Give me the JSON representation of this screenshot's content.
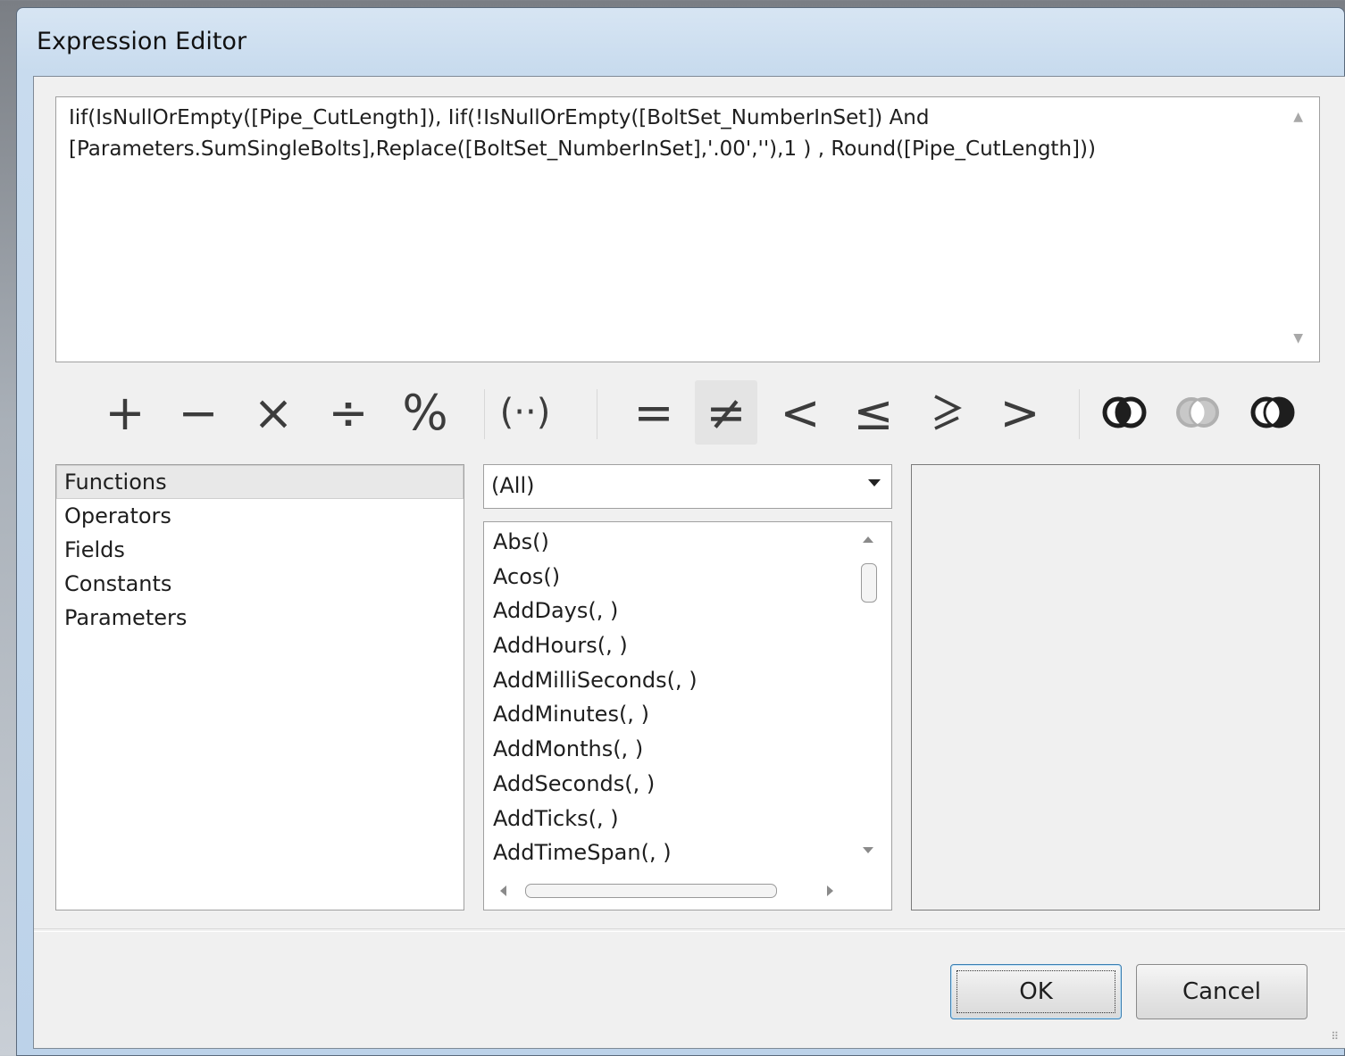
{
  "window": {
    "title": "Expression Editor"
  },
  "expression": {
    "text": "Iif(IsNullOrEmpty([Pipe_CutLength]), Iif(!IsNullOrEmpty([BoltSet_NumberInSet]) And\n[Parameters.SumSingleBolts],Replace([BoltSet_NumberInSet],'.00',''),1 ) , Round([Pipe_CutLength]))"
  },
  "toolbar": {
    "arithmetic": [
      "+",
      "−",
      "×",
      "÷",
      "%"
    ],
    "grouping": "(··)",
    "comparison": [
      "=",
      "≠",
      "<",
      "≤",
      ">",
      ">"
    ],
    "pressed_operator": "≠"
  },
  "categories": [
    "Functions",
    "Operators",
    "Fields",
    "Constants",
    "Parameters"
  ],
  "selected_category": "Functions",
  "filter": {
    "selected": "(All)"
  },
  "functions": [
    "Abs()",
    "Acos()",
    "AddDays(, )",
    "AddHours(, )",
    "AddMilliSeconds(, )",
    "AddMinutes(, )",
    "AddMonths(, )",
    "AddSeconds(, )",
    "AddTicks(, )",
    "AddTimeSpan(, )"
  ],
  "buttons": {
    "ok": "OK",
    "cancel": "Cancel"
  }
}
